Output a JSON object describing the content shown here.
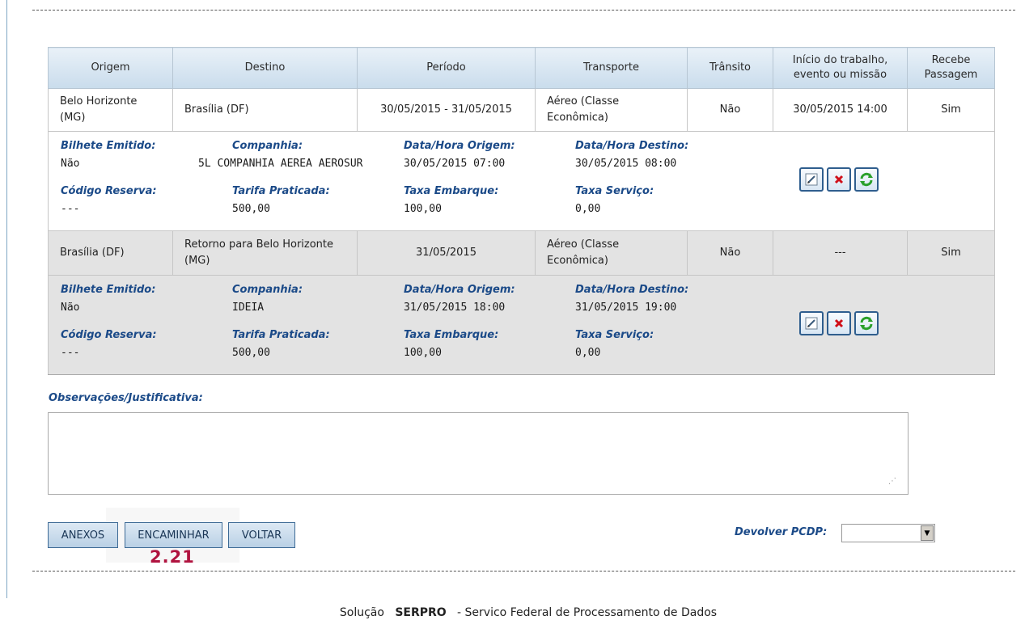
{
  "table": {
    "headers": [
      "Origem",
      "Destino",
      "Período",
      "Transporte",
      "Trânsito",
      "Início do trabalho, evento ou missão",
      "Recebe Passagem"
    ],
    "rows": [
      {
        "origem": "Belo Horizonte (MG)",
        "destino": "Brasília (DF)",
        "periodo": "30/05/2015 - 31/05/2015",
        "transporte": "Aéreo (Classe Econômica)",
        "transito": "Não",
        "inicio": "30/05/2015 14:00",
        "recebe": "Sim",
        "detail": {
          "bilhete_label": "Bilhete Emitido:",
          "bilhete_value": "Não",
          "companhia_label": "Companhia:",
          "companhia_value": "5L COMPANHIA AEREA AEROSUR",
          "origem_label": "Data/Hora Origem:",
          "origem_value": "30/05/2015  07:00",
          "destino_label": "Data/Hora Destino:",
          "destino_value": "30/05/2015  08:00",
          "reserva_label": "Código Reserva:",
          "reserva_value": "---",
          "tarifa_label": "Tarifa Praticada:",
          "tarifa_value": "500,00",
          "embarque_label": "Taxa Embarque:",
          "embarque_value": "100,00",
          "servico_label": "Taxa Serviço:",
          "servico_value": "0,00"
        }
      },
      {
        "origem": "Brasília (DF)",
        "destino": "Retorno para Belo Horizonte (MG)",
        "periodo": "31/05/2015",
        "transporte": "Aéreo (Classe Econômica)",
        "transito": "Não",
        "inicio": "---",
        "recebe": "Sim",
        "detail": {
          "bilhete_label": "Bilhete Emitido:",
          "bilhete_value": "Não",
          "companhia_label": "Companhia:",
          "companhia_value": "IDEIA",
          "origem_label": "Data/Hora Origem:",
          "origem_value": "31/05/2015 18:00",
          "destino_label": "Data/Hora Destino:",
          "destino_value": "31/05/2015 19:00",
          "reserva_label": "Código Reserva:",
          "reserva_value": "---",
          "tarifa_label": "Tarifa Praticada:",
          "tarifa_value": "500,00",
          "embarque_label": "Taxa Embarque:",
          "embarque_value": "100,00",
          "servico_label": "Taxa Serviço:",
          "servico_value": "0,00"
        }
      }
    ],
    "action_icons": [
      "edit-icon",
      "delete-icon",
      "refresh-icon"
    ]
  },
  "observacoes": {
    "label": "Observações/Justificativa:",
    "value": ""
  },
  "buttons": {
    "anexos": "ANEXOS",
    "encaminhar": "ENCAMINHAR",
    "voltar": "VOLTAR"
  },
  "annotation": {
    "tag": "2.21",
    "color": "#b0133f"
  },
  "devolver": {
    "label": "Devolver PCDP:",
    "selected": ""
  },
  "footer": {
    "prefix": "Solução",
    "brand": "SERPRO",
    "suffix": "- Servico Federal de Processamento de Dados"
  }
}
